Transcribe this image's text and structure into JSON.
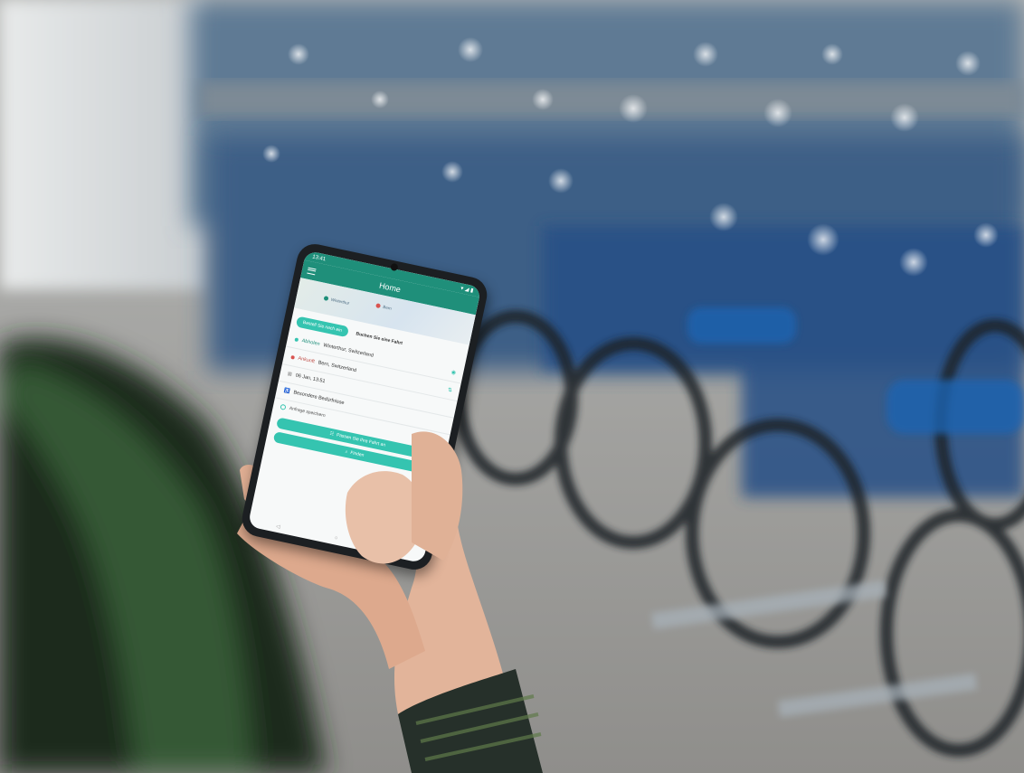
{
  "app": {
    "status_time": "13:41",
    "status_icons": "▾ ◢ ▮",
    "title": "Home",
    "map_labels": [
      "Winterthur",
      "Bern"
    ],
    "tabs": {
      "active": "Bestell Sie nach ein",
      "other": "Buchen Sie eine Fahrt"
    },
    "fields": [
      {
        "label": "Abholen",
        "value": "Winterthur, Switzerland",
        "dot": "teal"
      },
      {
        "label": "Ankunft",
        "value": "Bern, Switzerland",
        "dot": "red"
      },
      {
        "label": "",
        "value": "06 Jan, 13:51",
        "dot": "none"
      },
      {
        "label": "",
        "value": "Besondere Bedürfnisse",
        "dot": "none"
      }
    ],
    "checkbox_label": "Anfrage speichern",
    "buttons": {
      "passes": "Passen Sie Ihre Fahrt an",
      "search": "Finden"
    },
    "nav": [
      "◁",
      "○",
      "▢"
    ]
  },
  "colors": {
    "accent": "#35c4b0",
    "header": "#1f8f7a"
  }
}
